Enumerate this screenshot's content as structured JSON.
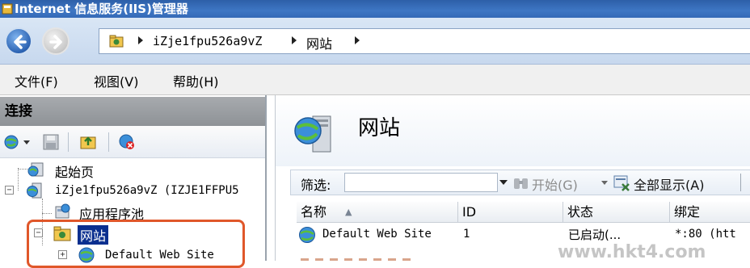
{
  "window": {
    "title": "Internet 信息服务(IIS)管理器"
  },
  "address": {
    "crumbs": [
      "iZje1fpu526a9vZ",
      "网站"
    ]
  },
  "menu": {
    "items": [
      "文件(F)",
      "视图(V)",
      "帮助(H)"
    ]
  },
  "connections": {
    "title": "连接",
    "tree": [
      {
        "label": "起始页"
      },
      {
        "label": "iZje1fpu526a9vZ (IZJE1FFPU5"
      },
      {
        "label": "应用程序池"
      },
      {
        "label": "网站"
      },
      {
        "label": "Default Web Site"
      }
    ]
  },
  "content": {
    "title": "网站",
    "filter": {
      "label": "筛选:",
      "start_label": "开始(G)",
      "show_all_label": "全部显示(A)"
    },
    "columns": [
      "名称",
      "ID",
      "状态",
      "绑定"
    ],
    "rows": [
      {
        "name": "Default Web Site",
        "id": "1",
        "status": "已启动(...",
        "binding": "*:80 (htt"
      }
    ]
  },
  "watermark": "www.hkt4.com",
  "colors": {
    "title_bar": "#2d5fa8",
    "selection": "#0a2f8f",
    "highlight_border": "#e0572a"
  }
}
